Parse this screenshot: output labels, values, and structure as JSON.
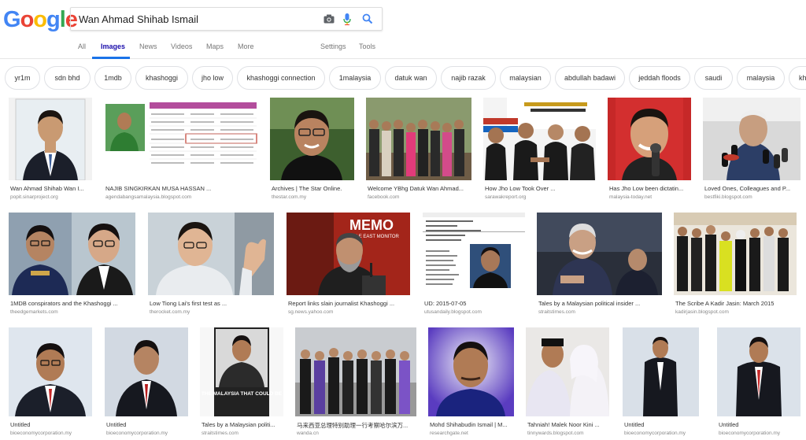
{
  "logo": [
    "G",
    "o",
    "o",
    "g",
    "l",
    "e"
  ],
  "search": {
    "value": "Wan Ahmad Shihab Ismail"
  },
  "tabs": [
    {
      "label": "All"
    },
    {
      "label": "Images"
    },
    {
      "label": "News"
    },
    {
      "label": "Videos"
    },
    {
      "label": "Maps"
    },
    {
      "label": "More"
    },
    {
      "label": "Settings"
    },
    {
      "label": "Tools"
    }
  ],
  "chips": [
    "yr1m",
    "sdn bhd",
    "1mdb",
    "khashoggi",
    "jho low",
    "khashoggi connection",
    "1malaysia",
    "datuk wan",
    "najib razak",
    "malaysian",
    "abdullah badawi",
    "jeddah floods",
    "saudi",
    "malaysia",
    "kh"
  ],
  "results": [
    {
      "title": "Wan Ahmad Shihab Wan I...",
      "source": "popit.sinarproject.org"
    },
    {
      "title": "NAJIB SINGKIRKAN MUSA HASSAN ...",
      "source": "agendabangsamalaysia.blogspot.com"
    },
    {
      "title": "Archives | The Star Online.",
      "source": "thestar.com.my"
    },
    {
      "title": "Welcome YBhg Datuk Wan Ahmad...",
      "source": "facebook.com"
    },
    {
      "title": "How Jho Low Took Over ...",
      "source": "sarawakreport.org"
    },
    {
      "title": "Has Jho Low been dictatin...",
      "source": "malaysia-today.net"
    },
    {
      "title": "Loved Ones, Colleagues and P...",
      "source": "bestfiki.blogspot.com"
    },
    {
      "title": "1MDB conspirators and the Khashoggi ...",
      "source": "theedgemarkets.com"
    },
    {
      "title": "Low Tiong Lai's first test as ...",
      "source": "therocket.com.my"
    },
    {
      "title": "Report links slain journalist Khashoggi ...",
      "source": "sg.news.yahoo.com"
    },
    {
      "title": "UD: 2015-07-05",
      "source": "utusandaily.blogspot.com"
    },
    {
      "title": "Tales by a Malaysian political insider ...",
      "source": "straitstimes.com"
    },
    {
      "title": "The Scribe A Kadir Jasin: March 2015",
      "source": "kadirjasin.blogspot.com"
    },
    {
      "title": "Untitled",
      "source": "bioeconomycorporation.my"
    },
    {
      "title": "Untitled",
      "source": "bioeconomycorporation.my"
    },
    {
      "title": "Tales by a Malaysian politi...",
      "source": "straitstimes.com"
    },
    {
      "title": "马来西亚总理特别助理一行考察哈尔滨万...",
      "source": "wanda.cn"
    },
    {
      "title": "Mohd Shihabudin Ismail | M...",
      "source": "researchgate.net"
    },
    {
      "title": "Tahniah! Malek Noor Kini ...",
      "source": "tinnywards.blogspot.com"
    },
    {
      "title": "Untitled",
      "source": "bioeconomycorporation.my"
    },
    {
      "title": "Untitled",
      "source": "bioeconomycorporation.my"
    }
  ],
  "thumb_texts": {
    "memo": "MEMO",
    "memo_sub": "MIDDLE EAST MONITOR",
    "book": "THE MALAYSIA THAT COULD BE"
  },
  "colors": {
    "link_blue": "#1a0dab",
    "tab_accent": "#1a73e8"
  }
}
